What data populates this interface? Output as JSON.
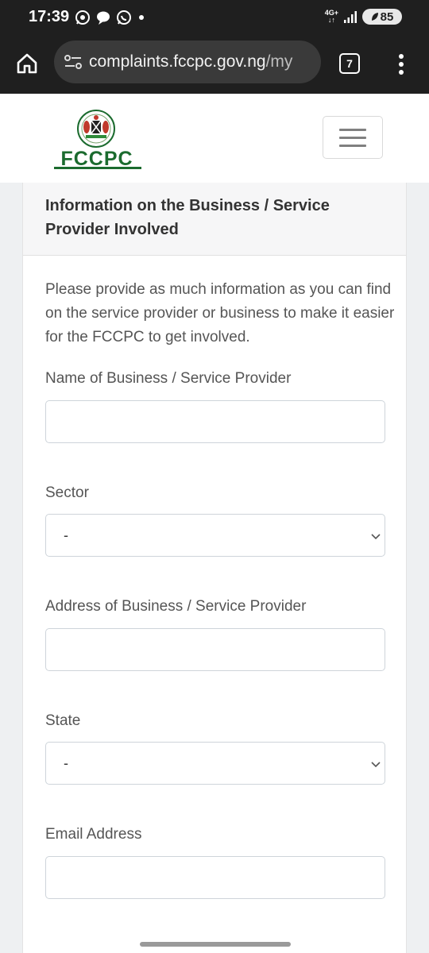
{
  "status_bar": {
    "time": "17:39",
    "network": "4G+",
    "battery": "85"
  },
  "browser": {
    "url_domain": "complaints.fccpc.gov.ng",
    "url_path": "/my",
    "tab_count": "7"
  },
  "header": {
    "logo_text": "FCCPC"
  },
  "form": {
    "section_title": "Information on the Business / Service Provider Involved",
    "intro": "Please provide as much information as you can find on the service provider or business to make it easier for the FCCPC to get involved.",
    "fields": {
      "business_name": {
        "label": "Name of Business / Service Provider",
        "value": ""
      },
      "sector": {
        "label": "Sector",
        "value": "-"
      },
      "address": {
        "label": "Address of Business / Service Provider",
        "value": ""
      },
      "state": {
        "label": "State",
        "value": "-"
      },
      "email": {
        "label": "Email Address",
        "value": ""
      }
    }
  },
  "colors": {
    "brand_green": "#1b6b2e",
    "browser_chrome": "#1f1f1f"
  }
}
